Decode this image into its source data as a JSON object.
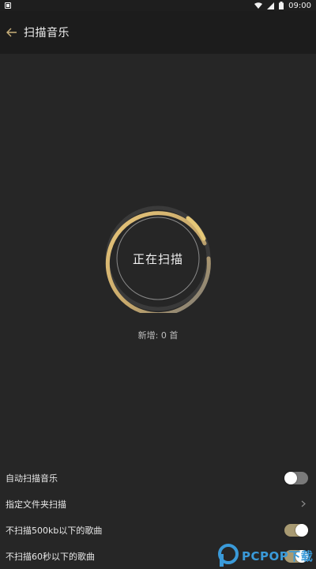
{
  "status_bar": {
    "time": "09:00"
  },
  "app_bar": {
    "title": "扫描音乐"
  },
  "scan": {
    "label": "正在扫描",
    "new_count_text": "新增: 0 首"
  },
  "settings": {
    "items": [
      {
        "label": "自动扫描音乐",
        "control": "toggle",
        "state": "off"
      },
      {
        "label": "指定文件夹扫描",
        "control": "chevron"
      },
      {
        "label": "不扫描500kb以下的歌曲",
        "control": "toggle",
        "state": "on"
      },
      {
        "label": "不扫描60秒以下的歌曲",
        "control": "toggle",
        "state": "on"
      }
    ]
  },
  "watermark": {
    "text": "PCPOP下载"
  },
  "colors": {
    "accent": "#d9b46a",
    "background": "#262626",
    "app_bar": "#1c1c1c",
    "watermark": "#3a9ad9"
  }
}
